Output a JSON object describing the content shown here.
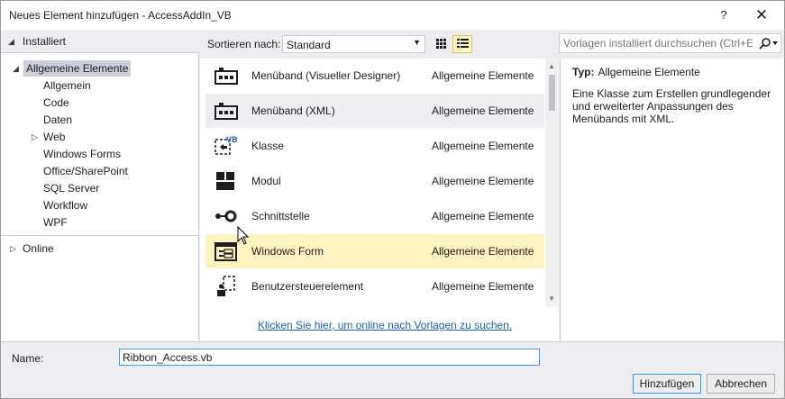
{
  "window": {
    "title": "Neues Element hinzufügen - AccessAddIn_VB",
    "help_label": "?",
    "close_label": "✕"
  },
  "tree": {
    "header": "Installiert",
    "nodes": [
      {
        "label": "Allgemeine Elemente",
        "caret": "◢",
        "selected": true
      },
      {
        "label": "Allgemein"
      },
      {
        "label": "Code"
      },
      {
        "label": "Daten"
      },
      {
        "label": "Web",
        "caret": "▷"
      },
      {
        "label": "Windows Forms"
      },
      {
        "label": "Office/SharePoint"
      },
      {
        "label": "SQL Server"
      },
      {
        "label": "Workflow"
      },
      {
        "label": "WPF"
      }
    ],
    "online": {
      "label": "Online",
      "caret": "▷"
    }
  },
  "toolbar": {
    "sort_label": "Sortieren nach:",
    "sort_value": "Standard",
    "sort_arrow": "▼",
    "grid_view_icon": "grid-view-icon",
    "list_view_icon": "list-view-icon"
  },
  "search": {
    "placeholder": "Vorlagen installiert durchsuchen (Ctrl+E)",
    "icon": "search-icon"
  },
  "templates": [
    {
      "name": "Menüband (Visueller Designer)",
      "category": "Allgemeine Elemente",
      "icon": "ribbon-icon"
    },
    {
      "name": "Menüband (XML)",
      "category": "Allgemeine Elemente",
      "icon": "ribbon-icon"
    },
    {
      "name": "Klasse",
      "category": "Allgemeine Elemente",
      "icon": "class-vb-icon",
      "icon_text": "VB"
    },
    {
      "name": "Modul",
      "category": "Allgemeine Elemente",
      "icon": "module-icon"
    },
    {
      "name": "Schnittstelle",
      "category": "Allgemeine Elemente",
      "icon": "interface-icon"
    },
    {
      "name": "Windows Form",
      "category": "Allgemeine Elemente",
      "icon": "windows-form-icon"
    },
    {
      "name": "Benutzersteuerelement",
      "category": "Allgemeine Elemente",
      "icon": "user-control-icon"
    }
  ],
  "online_link": "Klicken Sie hier, um online nach Vorlagen zu suchen.",
  "info": {
    "type_label": "Typ:",
    "type_value": "Allgemeine Elemente",
    "description": "Eine Klasse zum Erstellen grundlegender und erweiterter Anpassungen des Menübands mit XML."
  },
  "bottom": {
    "name_label": "Name:",
    "name_value": "Ribbon_Access.vb",
    "add_button": "Hinzufügen",
    "cancel_button": "Abbrechen"
  },
  "colors": {
    "selected_item": "#fdf4bf",
    "hover_item": "#eeeef2",
    "link": "#1a5fb4",
    "panel": "#eeeef2"
  }
}
